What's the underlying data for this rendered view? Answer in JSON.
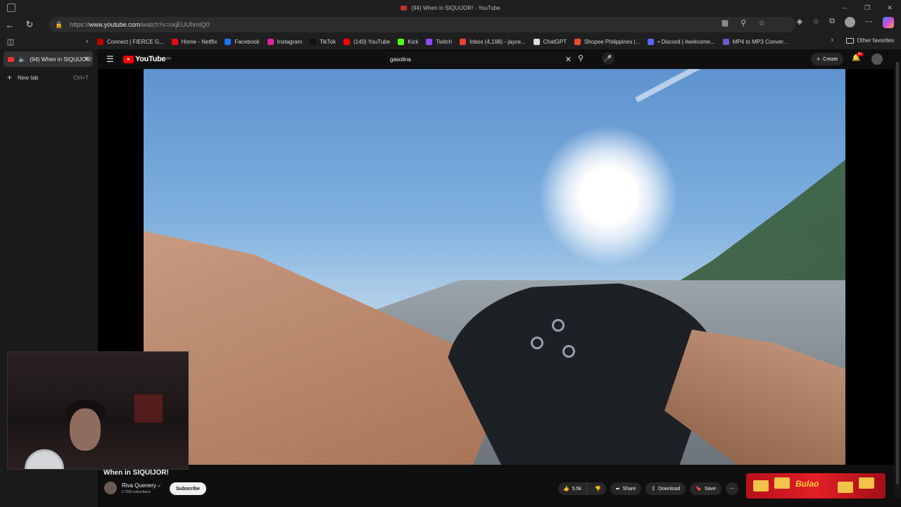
{
  "window": {
    "title": "(94) When in SIQUIJOR! - YouTube"
  },
  "address": {
    "url_prefix": "https://",
    "url_host": "www.youtube.com",
    "url_path": "/watch?v=nxjEUUhmtQ0"
  },
  "favorites": [
    {
      "label": "Connect | FIERCE G...",
      "color": "#c00000"
    },
    {
      "label": "Home - Netflix",
      "color": "#e50914"
    },
    {
      "label": "Facebook",
      "color": "#1877f2"
    },
    {
      "label": "Instagram",
      "color": "#d6249f"
    },
    {
      "label": "TikTok",
      "color": "#111111"
    },
    {
      "label": "(140) YouTube",
      "color": "#ff0000"
    },
    {
      "label": "Kick",
      "color": "#53fc18"
    },
    {
      "label": "Twitch",
      "color": "#9146ff"
    },
    {
      "label": "Inbox (4,198) - jayce...",
      "color": "#ea4335"
    },
    {
      "label": "ChatGPT",
      "color": "#dddddd"
    },
    {
      "label": "Shopee Philippines |...",
      "color": "#ee4d2d"
    },
    {
      "label": "• Discord | #welcome...",
      "color": "#5865f2"
    },
    {
      "label": "MP4 to MP3 Conver...",
      "color": "#6a5acd"
    }
  ],
  "favorites_other": "Other favorites",
  "sidebar": {
    "active_tab": "(94) When in SIQUIJOR!",
    "new_tab_label": "New tab",
    "new_tab_shortcut": "Ctrl+T"
  },
  "youtube": {
    "logo": "YouTube",
    "logo_country": "PH",
    "search_value": "gasolina",
    "create_label": "Create",
    "notif_count": "9+"
  },
  "video": {
    "title": "When in SIQUIJOR!",
    "channel": "Riva Quenery",
    "subscribers": "2.75M subscribers",
    "subscribe_label": "Subscribe",
    "likes": "5.5k",
    "share_label": "Share",
    "download_label": "Download",
    "save_label": "Save"
  },
  "ad": {
    "brand": "Bulao"
  },
  "icons": {
    "back": "back-icon",
    "refresh": "refresh-icon",
    "lock": "lock-icon",
    "search": "search-icon",
    "mic": "mic-icon",
    "bell": "bell-icon"
  }
}
